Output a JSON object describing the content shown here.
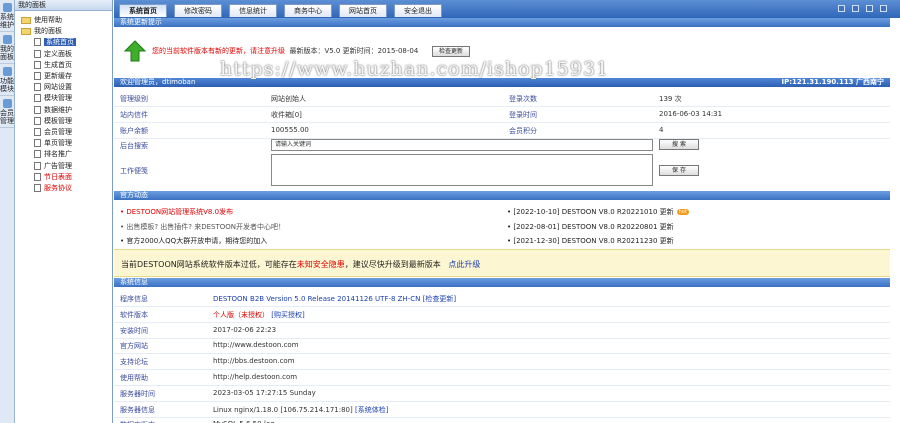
{
  "vtabs": [
    "系统维护",
    "我的面板",
    "功能模块",
    "会员管理"
  ],
  "sidebar": {
    "title": "我的面板",
    "items": [
      {
        "label": "使用帮助",
        "type": "folder",
        "indent": 0
      },
      {
        "label": "我的面板",
        "type": "folder",
        "indent": 0
      },
      {
        "label": "系统首页",
        "type": "page",
        "indent": 1,
        "selected": true
      },
      {
        "label": "定义面板",
        "type": "page",
        "indent": 1
      },
      {
        "label": "生成首页",
        "type": "page",
        "indent": 1
      },
      {
        "label": "更新缓存",
        "type": "page",
        "indent": 1
      },
      {
        "label": "网站设置",
        "type": "page",
        "indent": 1
      },
      {
        "label": "模块管理",
        "type": "page",
        "indent": 1
      },
      {
        "label": "数据维护",
        "type": "page",
        "indent": 1
      },
      {
        "label": "模板管理",
        "type": "page",
        "indent": 1
      },
      {
        "label": "会员管理",
        "type": "page",
        "indent": 1
      },
      {
        "label": "单页管理",
        "type": "page",
        "indent": 1
      },
      {
        "label": "排名推广",
        "type": "page",
        "indent": 1
      },
      {
        "label": "广告管理",
        "type": "page",
        "indent": 1
      },
      {
        "label": "节日表面",
        "type": "page",
        "indent": 1,
        "red": true
      },
      {
        "label": "服务协议",
        "type": "page",
        "indent": 1,
        "red": true
      }
    ]
  },
  "toptabs": [
    "系统首页",
    "修改密码",
    "信息统计",
    "商务中心",
    "网站首页",
    "安全退出"
  ],
  "update": {
    "section": "系统更新提示",
    "msg_red": "您的当前软件版本有新的更新，请注意升级",
    "msg_black": "最新版本：V5.0 更新时间：2015-08-04",
    "button": "检查更新"
  },
  "watermark": "https://www.huzhan.com/ishop15931",
  "login": {
    "left": "欢迎管理员，dtimoban",
    "right": "IP:121.31.190.113 广西南宁"
  },
  "account": {
    "rows": [
      {
        "l1": "管理级别",
        "v1": "网站创始人",
        "l2": "登录次数",
        "v2": "139 次"
      },
      {
        "l1": "站内信件",
        "v1": "收件箱[0]",
        "l2": "登录时间",
        "v2": "2016-06-03 14:31"
      },
      {
        "l1": "账户余额",
        "v1": "100555.00",
        "l2": "会员积分",
        "v2": "4"
      }
    ],
    "search_label": "后台搜索",
    "search_placeholder": "请输入关键词",
    "search_btn": "搜 索",
    "note_label": "工作便笺",
    "save_btn": "保 存"
  },
  "ads": {
    "section": "官方动态",
    "left": [
      {
        "text": "DESTOON网站管理系统V8.0发布",
        "color": "red"
      },
      {
        "text": "出售模板? 出售插件? 来DESTOON开发者中心吧！",
        "color": "gray"
      },
      {
        "text": "官方2000人QQ大群开放申请，期待您的加入",
        "color": "black"
      }
    ],
    "right": [
      {
        "date": "[2022-10-10]",
        "text": "DESTOON V8.0 R20221010 更新",
        "hot": "hot"
      },
      {
        "date": "[2022-08-01]",
        "text": "DESTOON V8.0 R20220801 更新"
      },
      {
        "date": "[2021-12-30]",
        "text": "DESTOON V8.0 R20211230 更新"
      }
    ]
  },
  "notice": {
    "pre": "当前DESTOON网站系统软件版本过低，可能存在",
    "red": "未知安全隐患",
    "post": "，建议尽快升级到最新版本",
    "link": "点此升级"
  },
  "sysinfo": {
    "section": "系统信息",
    "rows": [
      {
        "label": "程序信息",
        "value": "DESTOON B2B Version 5.0 Release 20141126 UTF-8 ZH-CN",
        "link": "[检查更新]",
        "blue": true
      },
      {
        "label": "软件版本",
        "value": "个人版（未授权）",
        "link": "[购买授权]",
        "redval": true
      },
      {
        "label": "安装时间",
        "value": "2017-02-06 22:23"
      },
      {
        "label": "官方网站",
        "value": "http://www.destoon.com"
      },
      {
        "label": "支持论坛",
        "value": "http://bbs.destoon.com"
      },
      {
        "label": "使用帮助",
        "value": "http://help.destoon.com"
      },
      {
        "label": "服务器时间",
        "value": "2023-03-05 17:27:15 Sunday"
      },
      {
        "label": "服务器信息",
        "value": "Linux nginx/1.18.0 [106.75.214.171:80]",
        "link": "[系统体检]"
      },
      {
        "label": "数据库版本",
        "value": "MySQL 5.6.50-log"
      }
    ]
  }
}
